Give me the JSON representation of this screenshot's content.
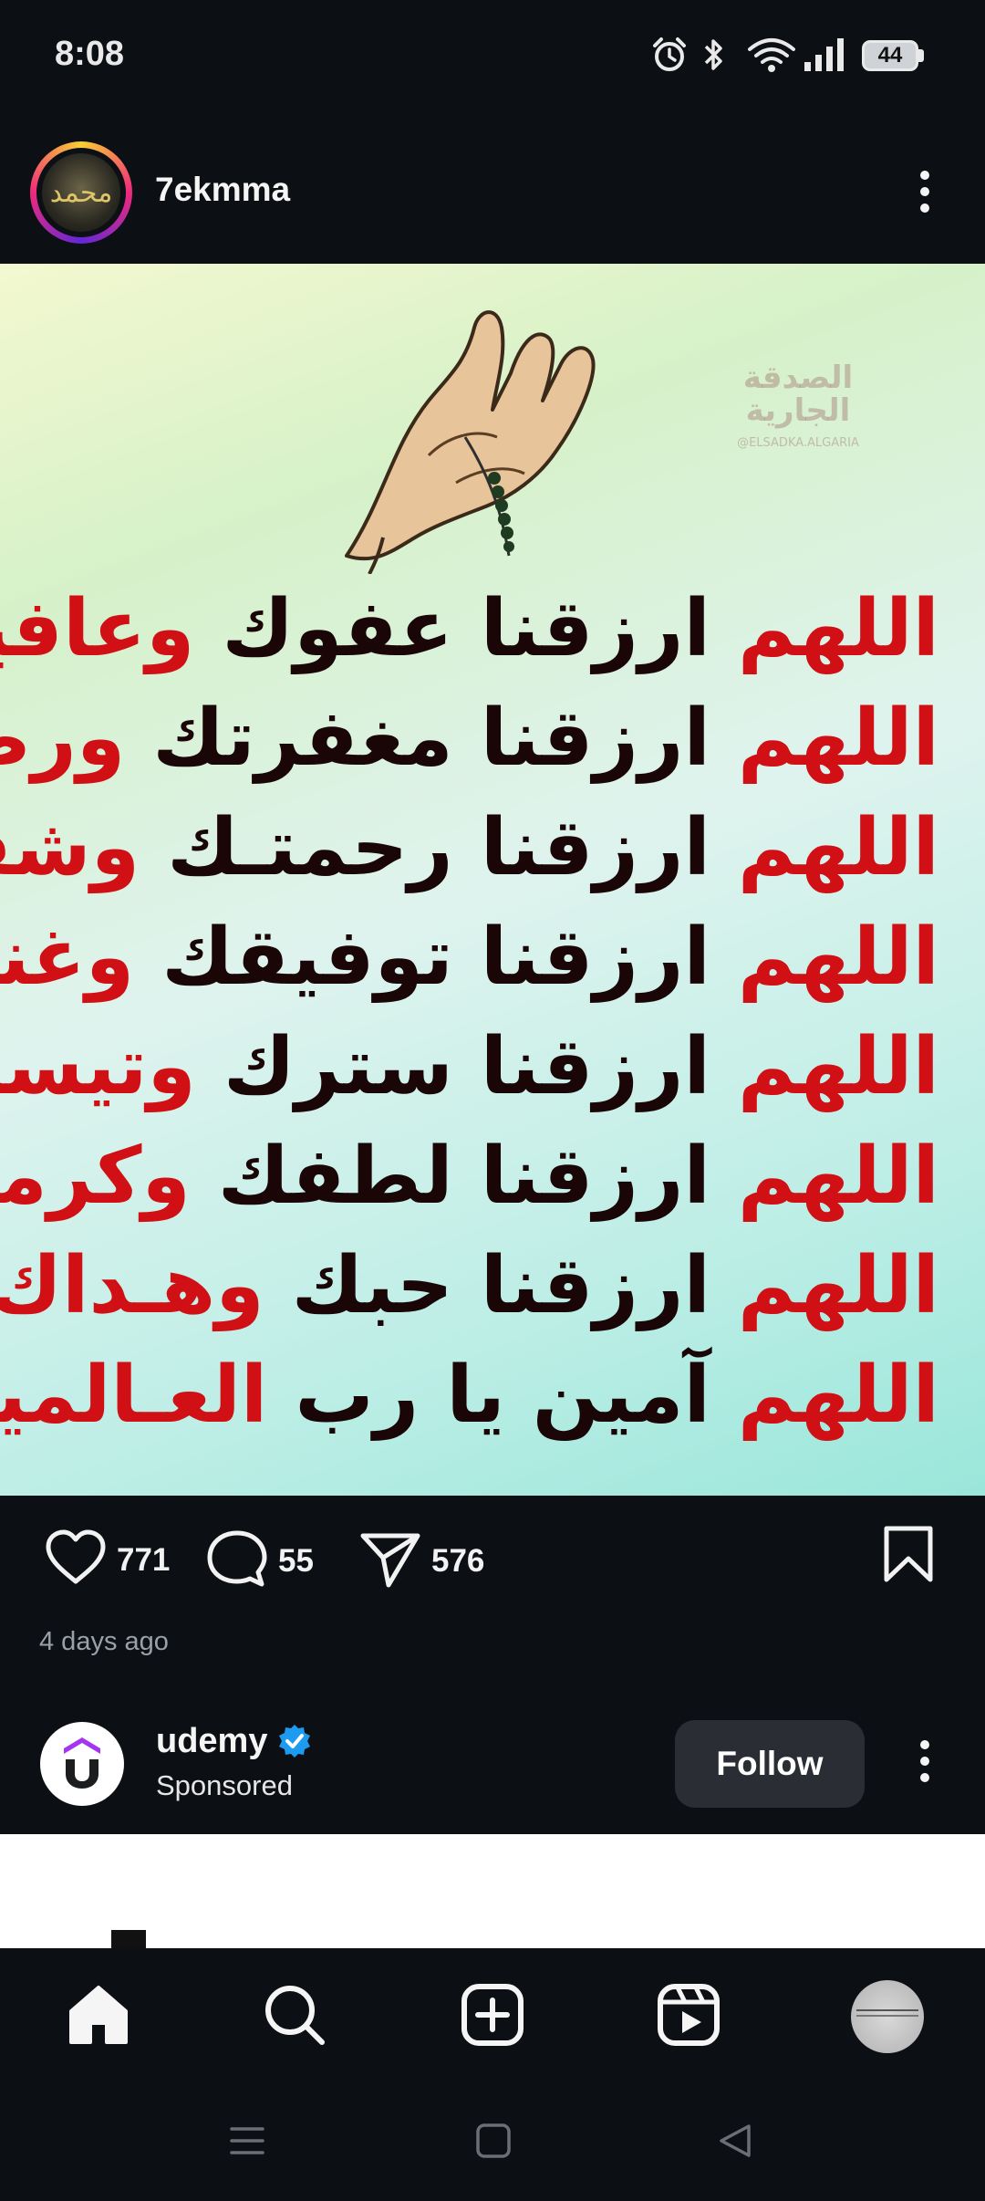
{
  "status_bar": {
    "time": "8:08",
    "battery": "44",
    "icons": [
      "alarm-icon",
      "bluetooth-icon",
      "wifi-icon",
      "signal-icon",
      "battery-icon"
    ]
  },
  "post": {
    "username": "7ekmma",
    "avatar_glyph": "محمد",
    "watermark": {
      "line1": "الصدقة",
      "line2": "الجارية",
      "line3": "@ELSADKA.ALGARIA"
    },
    "prayer_lines": [
      {
        "red_start": "اللهم",
        "black": " ارزقنا عفوك ",
        "red_end": "وعافيتك"
      },
      {
        "red_start": "اللهم",
        "black": " ارزقنا مغفرتك ",
        "red_end": "ورضاك"
      },
      {
        "red_start": "اللهم",
        "black": " ارزقنا رحمتـك ",
        "red_end": "وشفـاك"
      },
      {
        "red_start": "اللهم",
        "black": " ارزقنا توفيقك ",
        "red_end": "وغنـاك"
      },
      {
        "red_start": "اللهم",
        "black": " ارزقنا سترك ",
        "red_end": "وتيسيرك"
      },
      {
        "red_start": "اللهم",
        "black": " ارزقنا لطفك ",
        "red_end": "وكرمك"
      },
      {
        "red_start": "اللهم",
        "black": " ارزقنا حبك ",
        "red_end": "وهـداك"
      },
      {
        "red_start": "اللهم",
        "black": " آمين يا رب ",
        "red_end": "العـالمين"
      }
    ],
    "likes": "771",
    "comments": "55",
    "shares": "576",
    "timestamp": "4 days ago"
  },
  "sponsored": {
    "name": "udemy",
    "label": "Sponsored",
    "follow_label": "Follow",
    "verified": true
  },
  "colors": {
    "background": "#0c0f14",
    "follow_button": "#2a2d33",
    "verified_blue": "#1d9bf0",
    "udemy_purple": "#a435f0",
    "prayer_red": "#d01014"
  }
}
